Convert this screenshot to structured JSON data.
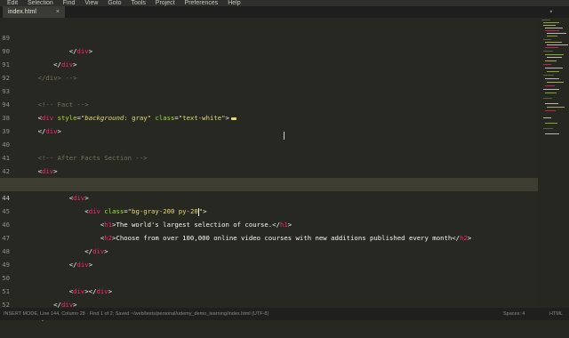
{
  "menu": [
    "Edit",
    "Selection",
    "Find",
    "View",
    "Goto",
    "Tools",
    "Project",
    "Preferences",
    "Help"
  ],
  "tab": {
    "name": "index.html",
    "close_icon": "×"
  },
  "editor": {
    "line_numbers": [
      "89",
      "90",
      "91",
      "92",
      "93",
      "94",
      "38",
      "39",
      "40",
      "41",
      "42",
      "43",
      "44",
      "45",
      "46",
      "47",
      "48",
      "49",
      "50",
      "51",
      "52"
    ],
    "current_line_number": "44"
  },
  "status": {
    "left": "INSERT MODE, Line 144, Column 28 · Find 1 of 2; Saved ~/web/tests/personal/udemy_demo_learning/index.html (UTF-8)",
    "spaces": "Spaces: 4",
    "syntax": "HTML"
  }
}
